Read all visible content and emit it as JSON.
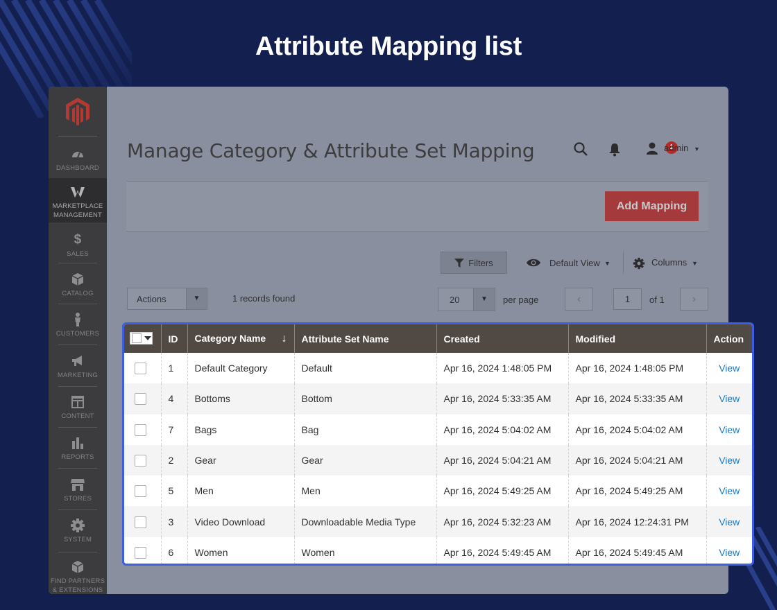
{
  "page_heading": "Attribute Mapping list",
  "admin": {
    "title": "Manage Category & Attribute Set Mapping",
    "notification_count": "1",
    "user": "admin",
    "add_button": "Add Mapping",
    "filters": "Filters",
    "view": "Default View",
    "columns": "Columns",
    "actions": "Actions",
    "records": "1 records found",
    "per_page_value": "20",
    "per_page_label": "per page",
    "page_value": "1",
    "of_pages": "of 1"
  },
  "sidebar": {
    "items": [
      {
        "label": "DASHBOARD",
        "icon": "dashboard-icon"
      },
      {
        "label": "MARKETPLACE MANAGEMENT",
        "icon": "marketplace-icon"
      },
      {
        "label": "SALES",
        "icon": "dollar-icon"
      },
      {
        "label": "CATALOG",
        "icon": "box-icon"
      },
      {
        "label": "CUSTOMERS",
        "icon": "person-icon"
      },
      {
        "label": "MARKETING",
        "icon": "megaphone-icon"
      },
      {
        "label": "CONTENT",
        "icon": "layout-icon"
      },
      {
        "label": "REPORTS",
        "icon": "bar-chart-icon"
      },
      {
        "label": "STORES",
        "icon": "store-icon"
      },
      {
        "label": "SYSTEM",
        "icon": "gear-icon"
      },
      {
        "label": "FIND PARTNERS & EXTENSIONS",
        "icon": "cube-icon"
      }
    ]
  },
  "table": {
    "headers": [
      "ID",
      "Category Name",
      "Attribute Set Name",
      "Created",
      "Modified",
      "Action"
    ],
    "sort_indicator": "↓",
    "rows": [
      {
        "id": "1",
        "category": "Default Category",
        "attribute_set": "Default",
        "created": "Apr 16, 2024 1:48:05 PM",
        "modified": "Apr 16, 2024 1:48:05 PM",
        "action": "View"
      },
      {
        "id": "4",
        "category": "Bottoms",
        "attribute_set": "Bottom",
        "created": "Apr 16, 2024 5:33:35 AM",
        "modified": "Apr 16, 2024 5:33:35 AM",
        "action": "View"
      },
      {
        "id": "7",
        "category": "Bags",
        "attribute_set": "Bag",
        "created": "Apr 16, 2024 5:04:02 AM",
        "modified": "Apr 16, 2024 5:04:02 AM",
        "action": "View"
      },
      {
        "id": "2",
        "category": "Gear",
        "attribute_set": "Gear",
        "created": "Apr 16, 2024 5:04:21 AM",
        "modified": "Apr 16, 2024 5:04:21 AM",
        "action": "View"
      },
      {
        "id": "5",
        "category": "Men",
        "attribute_set": "Men",
        "created": "Apr 16, 2024 5:49:25 AM",
        "modified": "Apr 16, 2024 5:49:25 AM",
        "action": "View"
      },
      {
        "id": "3",
        "category": "Video Download",
        "attribute_set": "Downloadable Media Type",
        "created": "Apr 16, 2024 5:32:23 AM",
        "modified": "Apr 16, 2024 12:24:31 PM",
        "action": "View"
      },
      {
        "id": "6",
        "category": "Women",
        "attribute_set": "Women",
        "created": "Apr 16, 2024 5:49:45 AM",
        "modified": "Apr 16, 2024 5:49:45 AM",
        "action": "View"
      }
    ]
  },
  "colors": {
    "background": "#13204f",
    "table_header": "#514944",
    "highlight_border": "#3c5fe0",
    "link": "#1979c3",
    "primary_button": "#a53a3c"
  }
}
